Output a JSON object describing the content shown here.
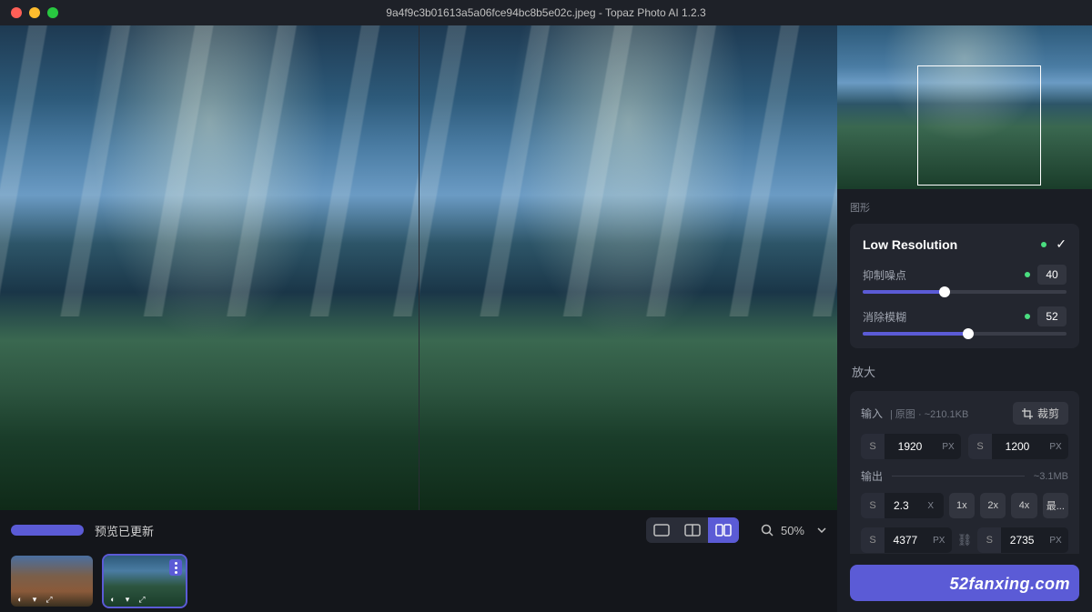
{
  "titlebar": {
    "title": "9a4f9c3b01613a5a06fce94bc8b5e02c.jpeg - Topaz Photo AI 1.2.3"
  },
  "toolbar": {
    "status_label": "预览已更新",
    "zoom_label": "50%"
  },
  "panel": {
    "truncated": "图形",
    "card_title": "Low Resolution",
    "sliders": {
      "noise": {
        "label": "抑制噪点",
        "value": "40",
        "pct": 40
      },
      "blur": {
        "label": "消除模糊",
        "value": "52",
        "pct": 52
      }
    },
    "enlarge_title": "放大",
    "input_section": {
      "label": "输入",
      "sub": "| 原图 · ~210.1KB",
      "crop_label": "裁剪",
      "width": "1920",
      "height": "1200",
      "unit": "PX",
      "s": "S"
    },
    "output_section": {
      "label": "输出",
      "size": "~3.1MB",
      "scale": {
        "s": "S",
        "value": "2.3",
        "unit": "X"
      },
      "presets": [
        "1x",
        "2x",
        "4x",
        "最..."
      ],
      "width": "4377",
      "height": "2735",
      "unit": "PX",
      "s": "S"
    }
  },
  "watermark": "52fanxing.com"
}
